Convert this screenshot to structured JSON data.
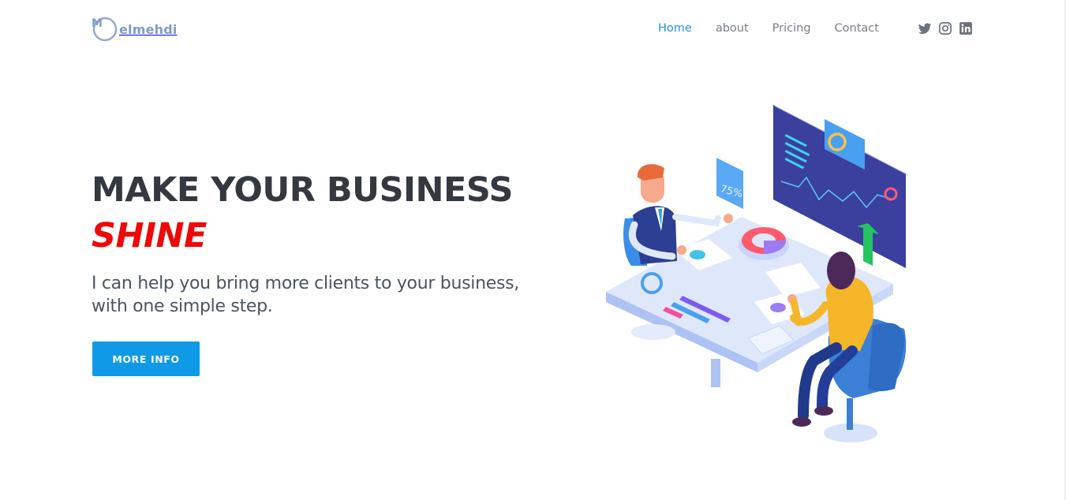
{
  "header": {
    "logo": {
      "mark": "M",
      "text": "elmehdi"
    },
    "nav": [
      {
        "label": "Home",
        "active": true
      },
      {
        "label": "about",
        "active": false
      },
      {
        "label": "Pricing",
        "active": false
      },
      {
        "label": "Contact",
        "active": false
      }
    ],
    "social_icons": [
      "twitter-icon",
      "instagram-icon",
      "linkedin-icon"
    ]
  },
  "hero": {
    "title_line1": "MAKE YOUR BUSINESS",
    "title_line2": "SHINE",
    "subtitle": "I can help you bring more clients to your business, with one simple step.",
    "cta_label": "MORE INFO"
  },
  "illustration": {
    "badge_text": "75%"
  },
  "colors": {
    "accent": "#0f9ae8",
    "active_nav": "#2196d6",
    "highlight": "#ee0808",
    "title": "#33393f"
  }
}
